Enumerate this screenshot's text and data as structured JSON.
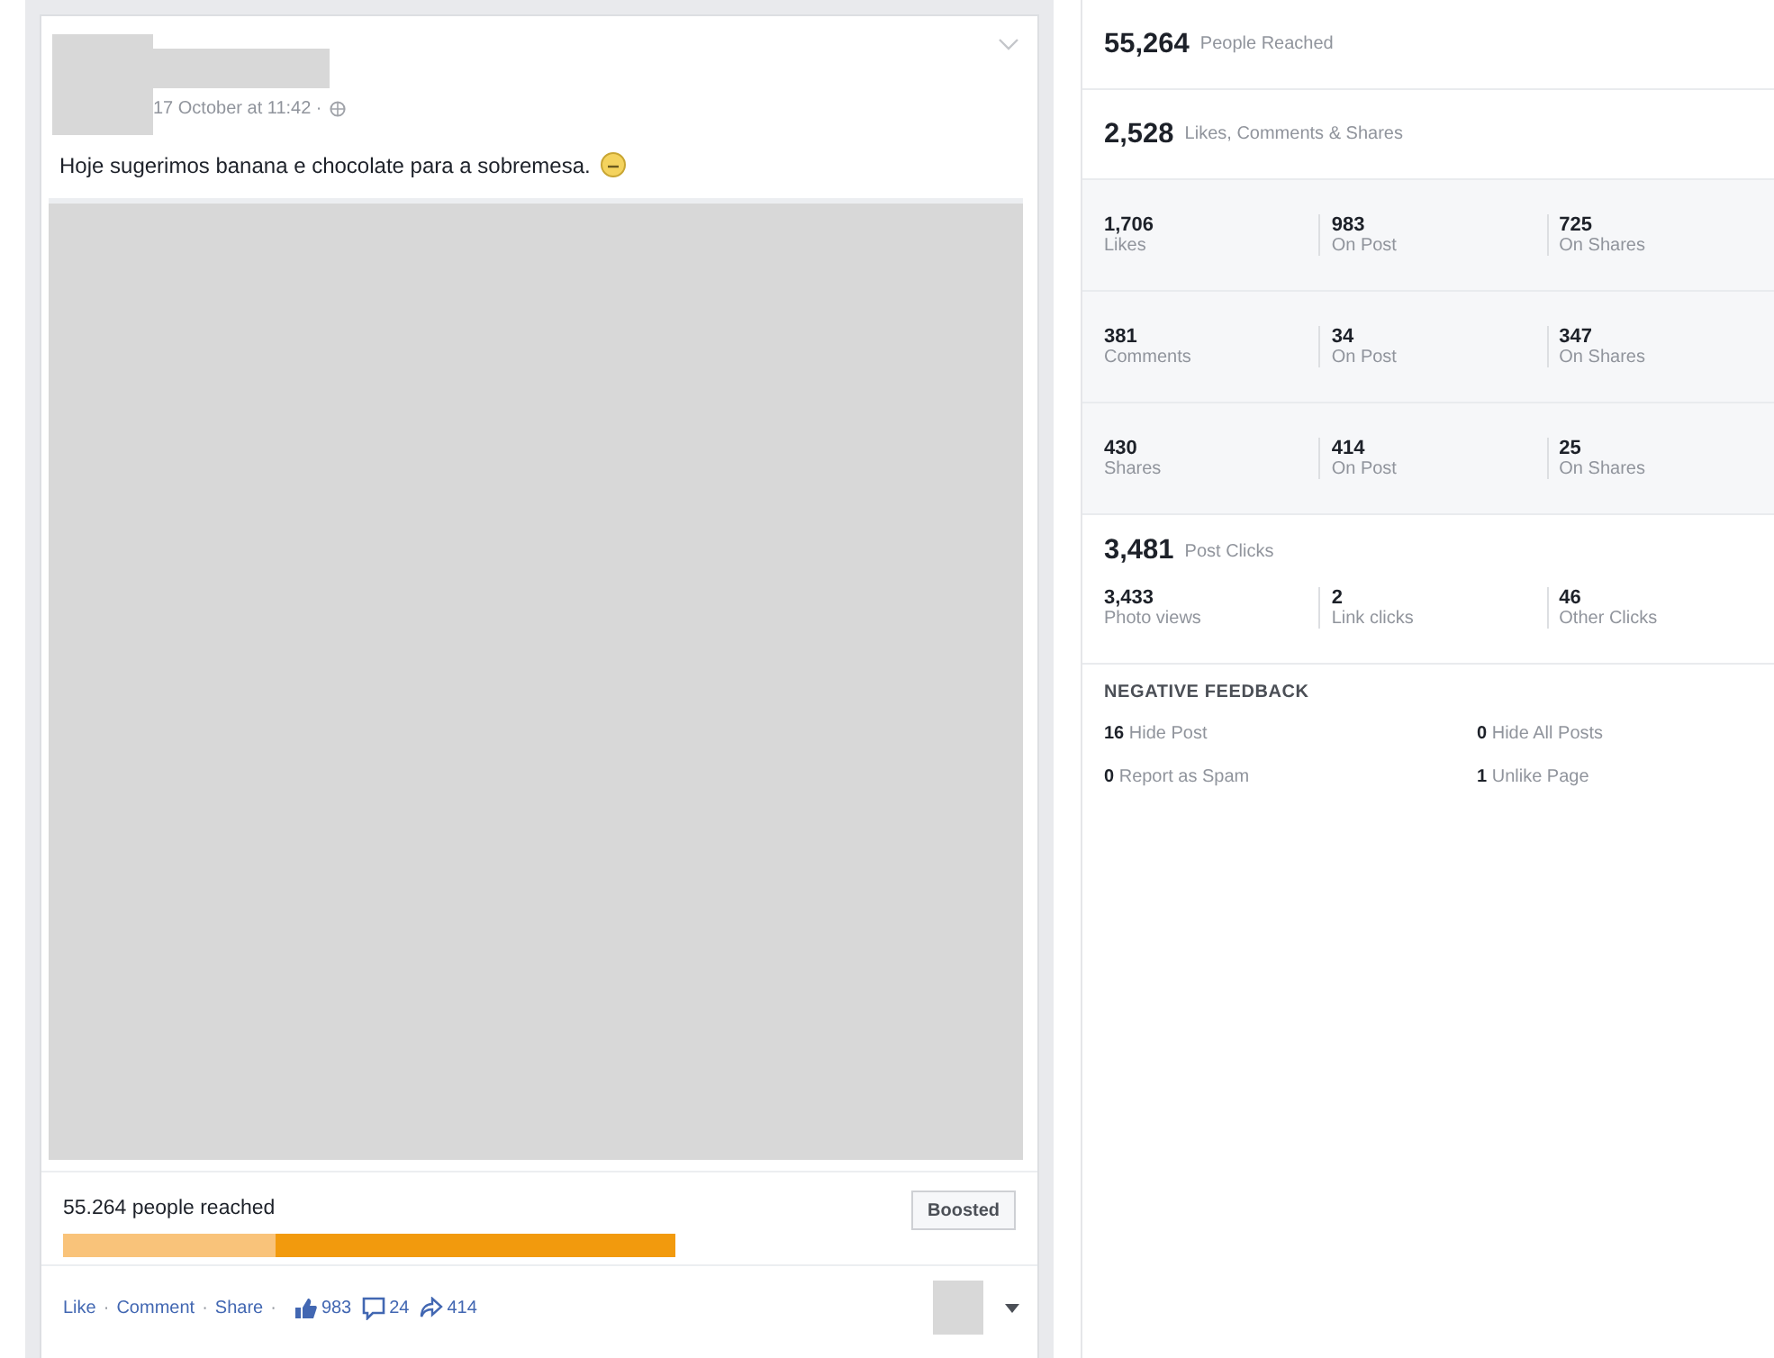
{
  "post": {
    "timestamp": "17 October at 11:42 ·",
    "text": "Hoje sugerimos banana e chocolate para a sobremesa.",
    "reach_text": "55.264 people reached",
    "reach_bar": [
      {
        "kind": "organic"
      },
      {
        "kind": "paid"
      }
    ],
    "separator": "·",
    "boost_button": "Boosted",
    "actions": [
      "Like",
      "Comment",
      "Share"
    ],
    "counts": [
      {
        "kind": "like",
        "value": "983"
      },
      {
        "kind": "comment",
        "value": "24"
      },
      {
        "kind": "share",
        "value": "414"
      }
    ]
  },
  "insights": {
    "reach": {
      "value": "55,264",
      "label": "People Reached"
    },
    "engagement": {
      "value": "2,528",
      "label": "Likes, Comments & Shares"
    },
    "engagement_rows": [
      [
        {
          "value": "1,706",
          "label": "Likes"
        },
        {
          "value": "983",
          "label": "On Post"
        },
        {
          "value": "725",
          "label": "On Shares"
        }
      ],
      [
        {
          "value": "381",
          "label": "Comments"
        },
        {
          "value": "34",
          "label": "On Post"
        },
        {
          "value": "347",
          "label": "On Shares"
        }
      ],
      [
        {
          "value": "430",
          "label": "Shares"
        },
        {
          "value": "414",
          "label": "On Post"
        },
        {
          "value": "25",
          "label": "On Shares"
        }
      ]
    ],
    "clicks": {
      "value": "3,481",
      "label": "Post Clicks"
    },
    "click_cells": [
      {
        "value": "3,433",
        "label": "Photo views"
      },
      {
        "value": "2",
        "label": "Link clicks"
      },
      {
        "value": "46",
        "label": "Other Clicks"
      }
    ],
    "negative_title": "NEGATIVE FEEDBACK",
    "negative": [
      {
        "value": "16",
        "label": "Hide Post"
      },
      {
        "value": "0",
        "label": "Hide All Posts"
      },
      {
        "value": "0",
        "label": "Report as Spam"
      },
      {
        "value": "1",
        "label": "Unlike Page"
      }
    ]
  }
}
